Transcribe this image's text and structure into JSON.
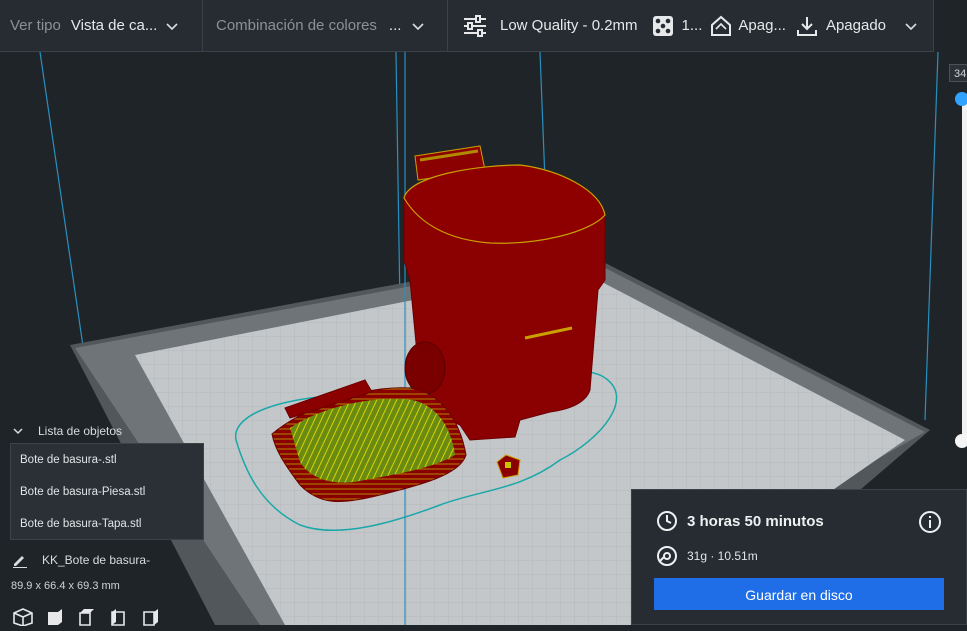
{
  "toolbar": {
    "view_type_label": "Ver tipo",
    "view_type_value": "Vista de ca...",
    "color_scheme_label": "Combinación de colores",
    "color_scheme_value": "...",
    "print_profile": "Low Quality - 0.2mm",
    "infill": "1...",
    "support": "Apag...",
    "adhesion": "Apagado"
  },
  "layer_slider": {
    "max_layer": "34"
  },
  "object_list": {
    "title": "Lista de objetos",
    "items": [
      "Bote de basura-.stl",
      "Bote de basura-Piesa.stl",
      "Bote de basura-Tapa.stl"
    ]
  },
  "selected_object": {
    "name": "KK_Bote de basura-",
    "dimensions": "89.9 x 66.4 x 69.3 mm"
  },
  "print_summary": {
    "time": "3 horas 50 minutos",
    "material": "31g · 10.51m",
    "save_button": "Guardar en disco"
  },
  "colors": {
    "accent": "#1f6ee8",
    "slider_handle": "#2fa3ff",
    "model_red": "#8b0000",
    "infill_yellow": "#c8c800",
    "skirt_cyan": "#19a8a8"
  }
}
